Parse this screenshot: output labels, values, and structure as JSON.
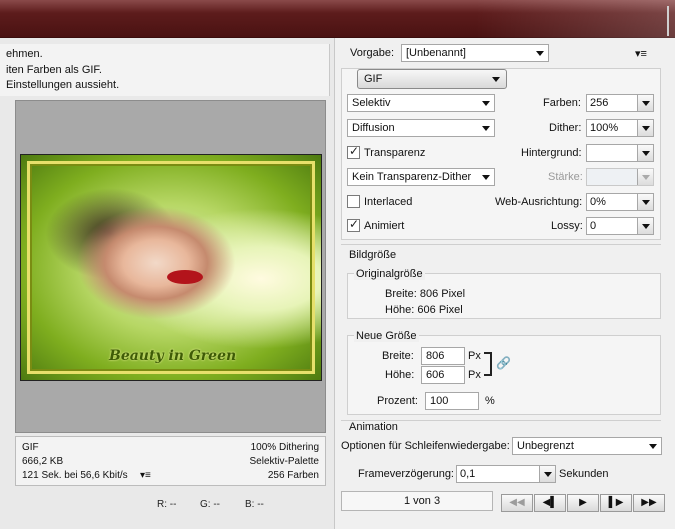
{
  "left_info": {
    "line1": "ehmen.",
    "line2": "iten Farben als GIF.",
    "line3": "Einstellungen aussieht."
  },
  "preview": {
    "signature": "Beauty in Green"
  },
  "status": {
    "format": "GIF",
    "size": "666,2 KB",
    "time": "121 Sek. bei 56,6 Kbit/s",
    "dither_pct": "100% Dithering",
    "palette": "Selektiv-Palette",
    "colors": "256 Farben",
    "menu_icon": "▾≡"
  },
  "rgb": {
    "r": "R: --",
    "g": "G: --",
    "b": "B: --"
  },
  "preset": {
    "label": "Vorgabe:",
    "value": "[Unbenannt]",
    "menu_icon": "▾≡"
  },
  "format": {
    "value": "GIF"
  },
  "settings": {
    "reduction": "Selektiv",
    "farben_label": "Farben:",
    "farben_value": "256",
    "dither_algo": "Diffusion",
    "dither_label": "Dither:",
    "dither_value": "100%",
    "transparenz_label": "Transparenz",
    "hintergrund_label": "Hintergrund:",
    "hintergrund_value": "",
    "transparency_dither": "Kein Transparenz-Dither",
    "staerke_label": "Stärke:",
    "staerke_value": "",
    "interlaced_label": "Interlaced",
    "web_label": "Web-Ausrichtung:",
    "web_value": "0%",
    "animiert_label": "Animiert",
    "lossy_label": "Lossy:",
    "lossy_value": "0"
  },
  "image_size": {
    "title": "Bildgröße",
    "orig_title": "Originalgröße",
    "orig_width": "Breite:  806 Pixel",
    "orig_height": "Höhe:  606 Pixel",
    "new_title": "Neue Größe",
    "width_label": "Breite:",
    "width_value": "806",
    "height_label": "Höhe:",
    "height_value": "606",
    "unit": "Px",
    "percent_label": "Prozent:",
    "percent_value": "100",
    "percent_unit": "%"
  },
  "animation": {
    "title": "Animation",
    "loop_label": "Optionen für Schleifenwiedergabe:",
    "loop_value": "Unbegrenzt",
    "delay_label": "Frameverzögerung:",
    "delay_value": "0,1",
    "delay_unit": "Sekunden",
    "frame_counter": "1 von 3",
    "btn_first": "◀◀",
    "btn_prev": "◀▌",
    "btn_play": "▶",
    "btn_next": "▌▶",
    "btn_last": "▶▶"
  }
}
